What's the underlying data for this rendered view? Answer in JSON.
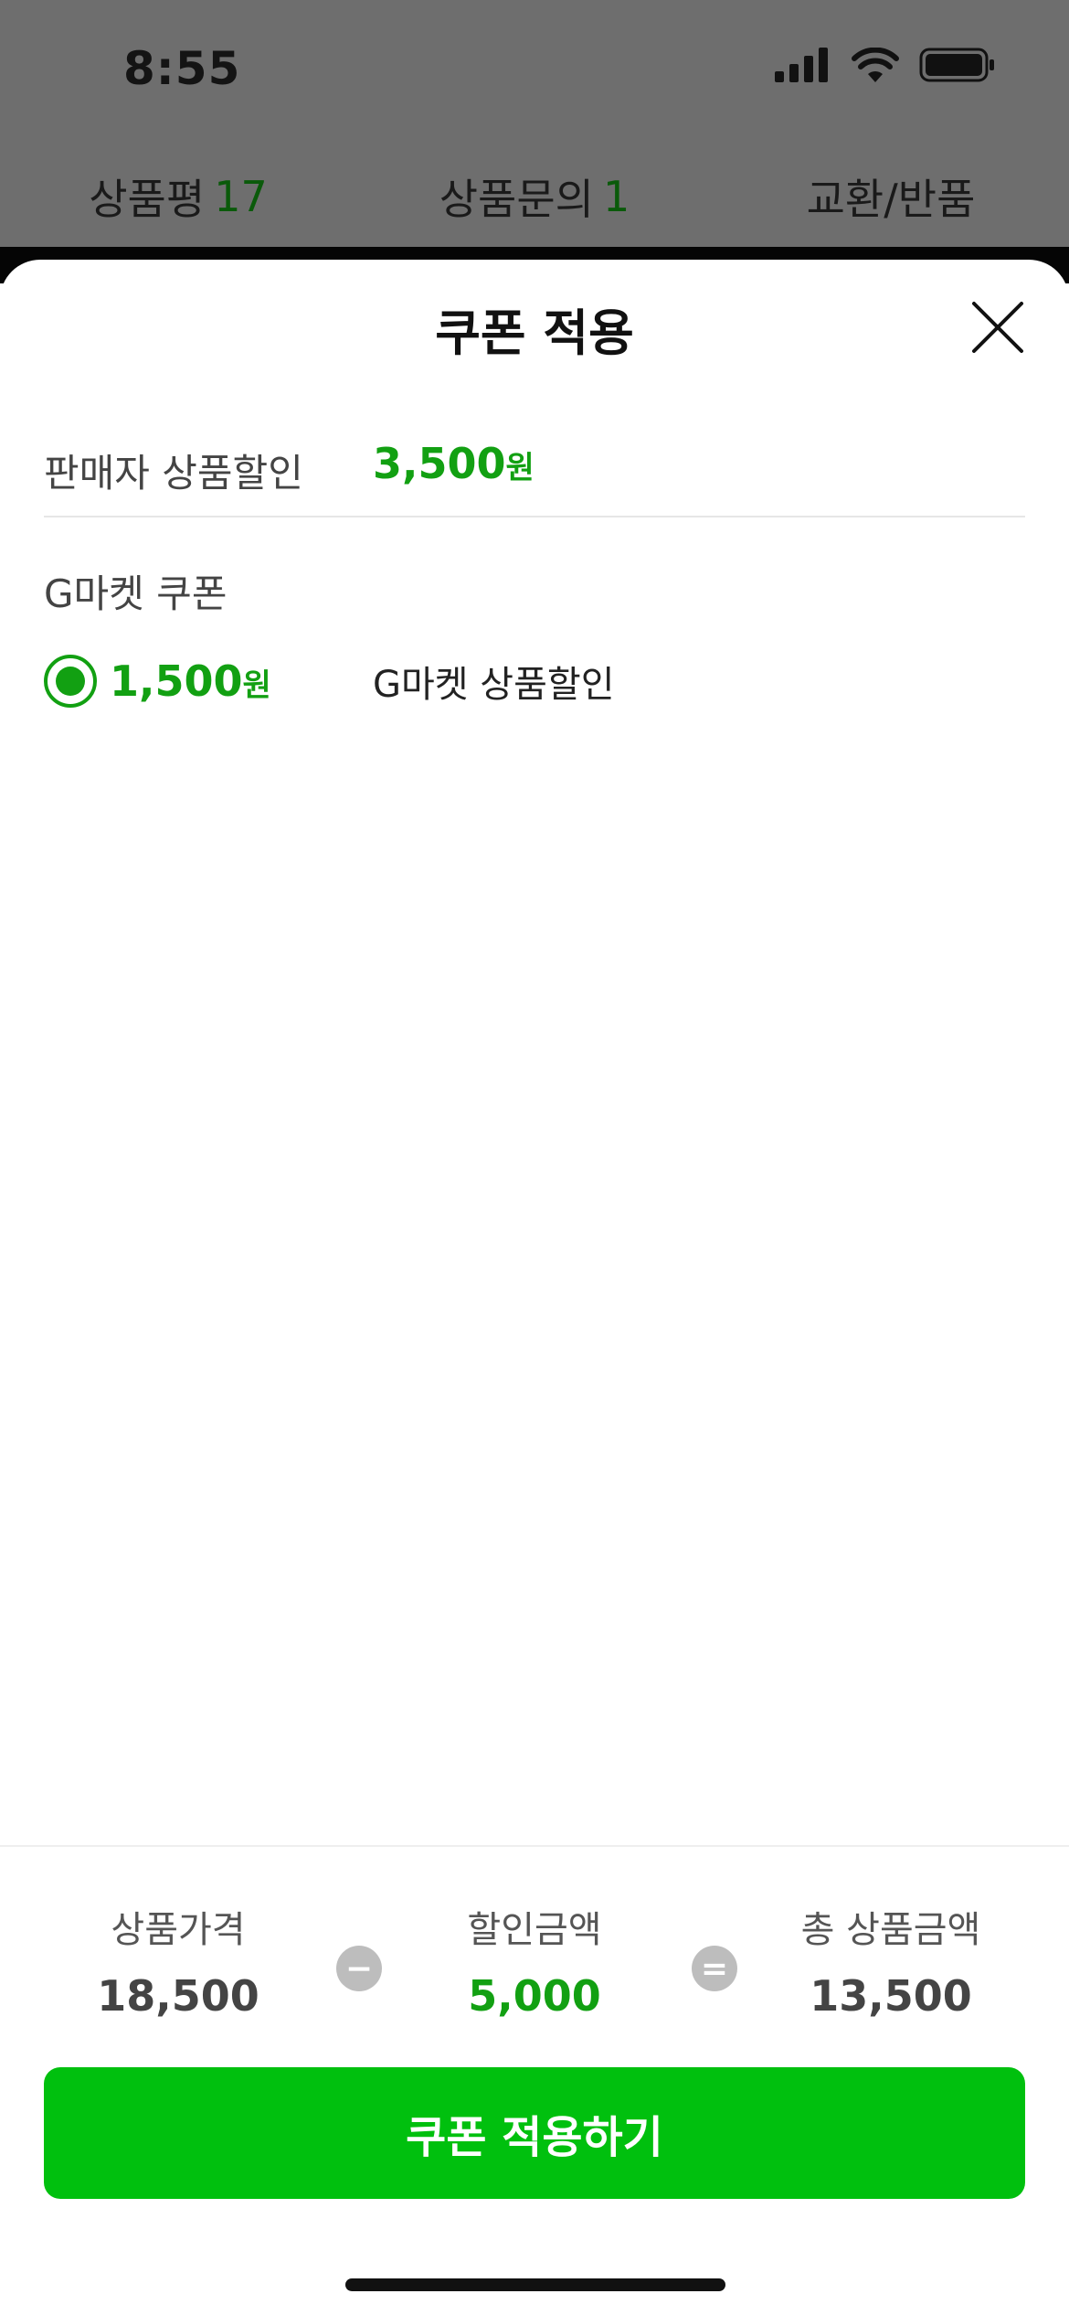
{
  "status_bar": {
    "time": "8:55"
  },
  "background_tabs": [
    {
      "label": "상품평",
      "count": "17"
    },
    {
      "label": "상품문의",
      "count": "1"
    },
    {
      "label": "교환/반품",
      "count": ""
    }
  ],
  "sheet": {
    "title": "쿠폰 적용",
    "seller_discount": {
      "label": "판매자 상품할인",
      "amount": "3,500",
      "unit": "원"
    },
    "gmarket_coupon": {
      "section_title": "G마켓 쿠폰",
      "item": {
        "amount": "1,500",
        "unit": "원",
        "name": "G마켓 상품할인",
        "selected": true
      }
    },
    "summary": {
      "price_label": "상품가격",
      "price_value": "18,500",
      "minus_symbol": "−",
      "discount_label": "할인금액",
      "discount_value": "5,000",
      "equals_symbol": "=",
      "total_label": "총 상품금액",
      "total_value": "13,500"
    },
    "apply_button": "쿠폰 적용하기"
  },
  "colors": {
    "accent": "#12a012",
    "button": "#00c00e",
    "overlay": "#6e6e6e"
  },
  "icons": [
    "cellular-signal-icon",
    "wifi-icon",
    "battery-icon",
    "close-icon",
    "radio-selected-icon"
  ]
}
